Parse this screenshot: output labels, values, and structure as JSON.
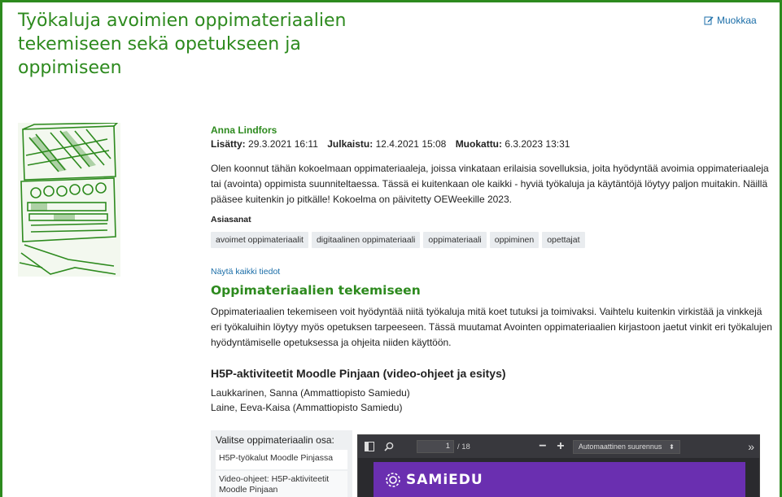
{
  "page": {
    "title": "Työkaluja avoimien oppimateriaalien tekemiseen sekä opetukseen ja oppimiseen",
    "edit_label": "Muokkaa"
  },
  "meta": {
    "author": "Anna Lindfors",
    "added_label": "Lisätty:",
    "added_value": "29.3.2021 16:11",
    "published_label": "Julkaistu:",
    "published_value": "12.4.2021 15:08",
    "modified_label": "Muokattu:",
    "modified_value": "6.3.2023 13:31"
  },
  "description": "Olen koonnut tähän kokoelmaan oppimateriaaleja, joissa vinkataan erilaisia sovelluksia, joita hyödyntää avoimia oppimateriaaleja tai (avointa) oppimista suunniteltaessa. Tässä ei kuitenkaan ole kaikki - hyviä työkaluja ja käytäntöjä löytyy paljon muitakin. Näillä pääsee kuitenkin jo pitkälle! Kokoelma on päivitetty OEWeekille 2023.",
  "keywords": {
    "title": "Asiasanat",
    "tags": [
      "avoimet oppimateriaalit",
      "digitaalinen oppimateriaali",
      "oppimateriaali",
      "oppiminen",
      "opettajat"
    ]
  },
  "show_all_label": "Näytä kaikki tiedot",
  "section": {
    "title": "Oppimateriaalien tekemiseen",
    "body": "Oppimateriaalien tekemiseen voit hyödyntää niitä työkaluja mitä koet tutuksi ja toimivaksi. Vaihtelu kuitenkin virkistää ja vinkkejä eri työkaluihin löytyy myös opetuksen tarpeeseen. Tässä muutamat Avointen oppimateriaalien kirjastoon jaetut vinkit eri työkalujen hyödyntämiselle opetuksessa ja ohjeita niiden käyttöön."
  },
  "material": {
    "title": "H5P-aktiviteetit Moodle Pinjaan (video-ohjeet ja esitys)",
    "authors": [
      "Laukkarinen, Sanna (Ammattiopisto Samiedu)",
      "Laine, Eeva-Kaisa (Ammattiopisto Samiedu)"
    ]
  },
  "chooser": {
    "title": "Valitse oppimateriaalin osa:",
    "items": [
      "H5P-työkalut Moodle Pinjassa",
      "Video-ohjeet: H5P-aktiviteetit Moodle Pinjaan"
    ]
  },
  "viewer": {
    "page_value": "1",
    "page_count": "/ 18",
    "zoom_label": "Automaattinen suurennus",
    "brand": "SAMiEDU",
    "icons": [
      "sidebar-toggle-icon",
      "search-icon",
      "zoom-out-icon",
      "zoom-in-icon",
      "more-tools-icon"
    ]
  },
  "colors": {
    "accent_green": "#2d8a1e",
    "link_blue": "#1b6ea8",
    "brand_purple": "#6a2fb0"
  }
}
